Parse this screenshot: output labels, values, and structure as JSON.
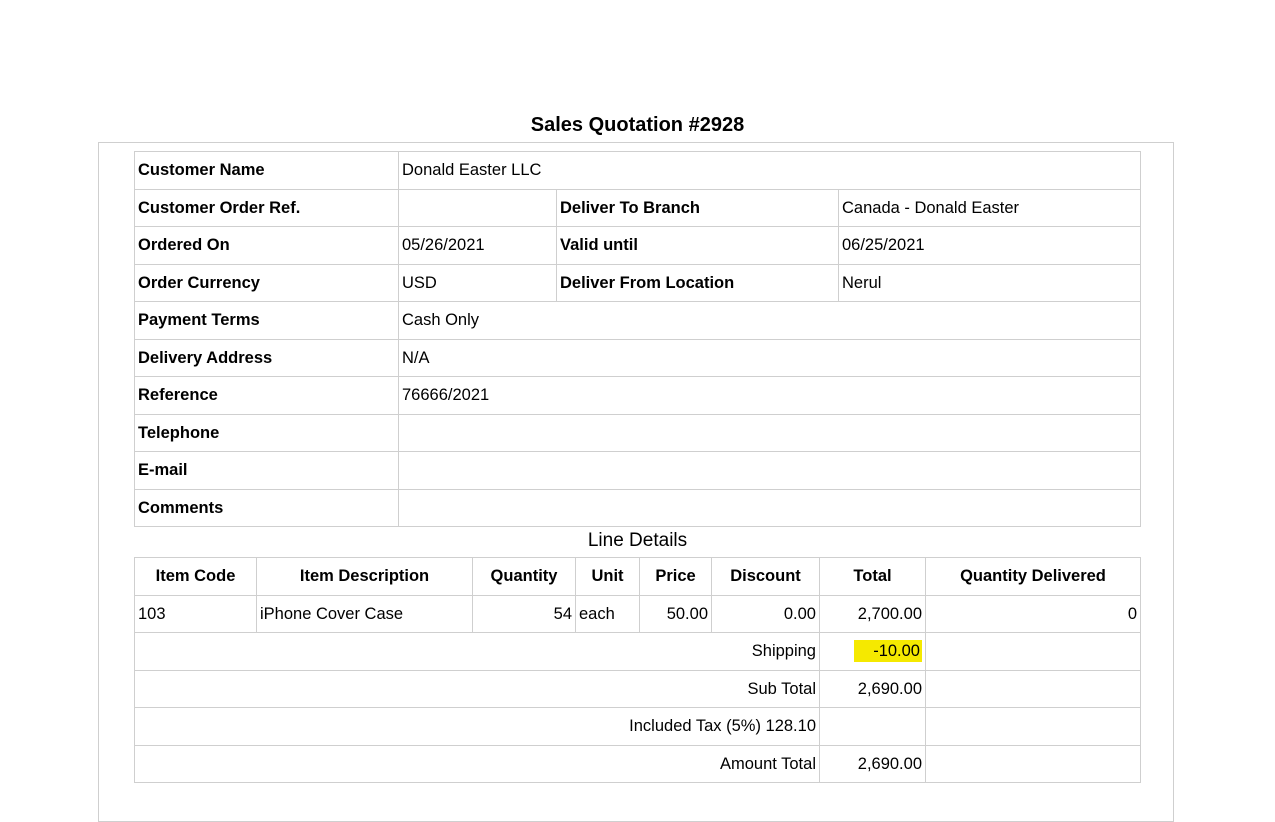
{
  "document": {
    "title": "Sales Quotation #2928"
  },
  "header": {
    "customer_name_label": "Customer Name",
    "customer_name": "Donald Easter LLC",
    "customer_order_ref_label": "Customer Order Ref.",
    "customer_order_ref": "",
    "deliver_to_branch_label": "Deliver To Branch",
    "deliver_to_branch": "Canada - Donald Easter",
    "ordered_on_label": "Ordered On",
    "ordered_on": "05/26/2021",
    "valid_until_label": "Valid until",
    "valid_until": "06/25/2021",
    "order_currency_label": "Order Currency",
    "order_currency": "USD",
    "deliver_from_location_label": "Deliver From Location",
    "deliver_from_location": "Nerul",
    "payment_terms_label": "Payment Terms",
    "payment_terms": "Cash Only",
    "delivery_address_label": "Delivery Address",
    "delivery_address": "N/A",
    "reference_label": "Reference",
    "reference": "76666/2021",
    "telephone_label": "Telephone",
    "telephone": "",
    "email_label": "E-mail",
    "email": "",
    "comments_label": "Comments",
    "comments": ""
  },
  "line_details": {
    "title": "Line Details",
    "columns": [
      "Item Code",
      "Item Description",
      "Quantity",
      "Unit",
      "Price",
      "Discount",
      "Total",
      "Quantity Delivered"
    ],
    "rows": [
      {
        "item_code": "103",
        "description": "iPhone Cover Case",
        "quantity": "54",
        "unit": "each",
        "price": "50.00",
        "discount": "0.00",
        "total": "2,700.00",
        "quantity_delivered": "0"
      }
    ],
    "shipping_label": "Shipping",
    "shipping": "-10.00",
    "subtotal_label": "Sub Total",
    "subtotal": "2,690.00",
    "tax_label": "Included Tax (5%) 128.10",
    "amount_total_label": "Amount Total",
    "amount_total": "2,690.00"
  },
  "colors": {
    "highlight": "#f5e900",
    "border": "#cfcfcf"
  }
}
